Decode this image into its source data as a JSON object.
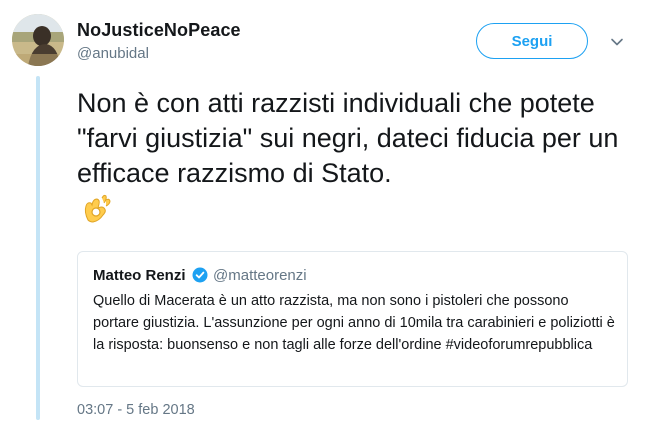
{
  "author": {
    "display_name": "NoJusticeNoPeace",
    "handle": "@anubidal"
  },
  "follow_button": {
    "label": "Segui"
  },
  "menu": {
    "icon": "chevron-down-icon"
  },
  "tweet": {
    "text": "Non è con atti razzisti individuali che potete \"farvi giustizia\" sui negri, dateci fiducia per un efficace razzismo di Stato.",
    "emoji_icon": "ok-hand-emoji"
  },
  "quoted_tweet": {
    "display_name": "Matteo Renzi",
    "verified_icon": "verified-badge-icon",
    "handle": "@matteorenzi",
    "text": "Quello di Macerata è un atto razzista, ma non sono i pistoleri che possono portare giustizia. L'assunzione per ogni anno di 10mila tra carabinieri e poliziotti è la risposta: buonsenso e non tagli alle forze dell'ordine #videoforumrepubblica"
  },
  "timestamp": "03:07 - 5 feb 2018",
  "colors": {
    "accent": "#1da1f2",
    "thread_line": "#c4e4f6",
    "secondary_text": "#657786",
    "border": "#e1e8ed"
  }
}
